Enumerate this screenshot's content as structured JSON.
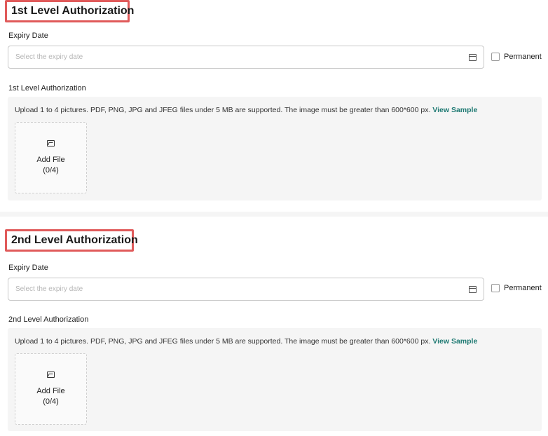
{
  "sections": [
    {
      "title": "1st Level Authorization",
      "expiry_label": "Expiry Date",
      "expiry_placeholder": "Select the expiry date",
      "permanent_label": "Permanent",
      "upload_label": "1st Level Authorization",
      "upload_info": "Upload 1 to 4 pictures. PDF, PNG, JPG and JFEG files under 5 MB are supported. The image must be greater than 600*600 px.",
      "view_sample": "View Sample",
      "add_file_label": "Add File",
      "add_file_count": "(0/4)"
    },
    {
      "title": "2nd Level Authorization",
      "expiry_label": "Expiry Date",
      "expiry_placeholder": "Select the expiry date",
      "permanent_label": "Permanent",
      "upload_label": "2nd Level Authorization",
      "upload_info": "Upload 1 to 4 pictures. PDF, PNG, JPG and JFEG files under 5 MB are supported. The image must be greater than 600*600 px.",
      "view_sample": "View Sample",
      "add_file_label": "Add File",
      "add_file_count": "(0/4)"
    }
  ],
  "colors": {
    "highlight_border": "#e05a5a",
    "link": "#1f7a73",
    "panel_bg": "#f5f5f5"
  },
  "icons": [
    "calendar-icon",
    "image-icon"
  ]
}
